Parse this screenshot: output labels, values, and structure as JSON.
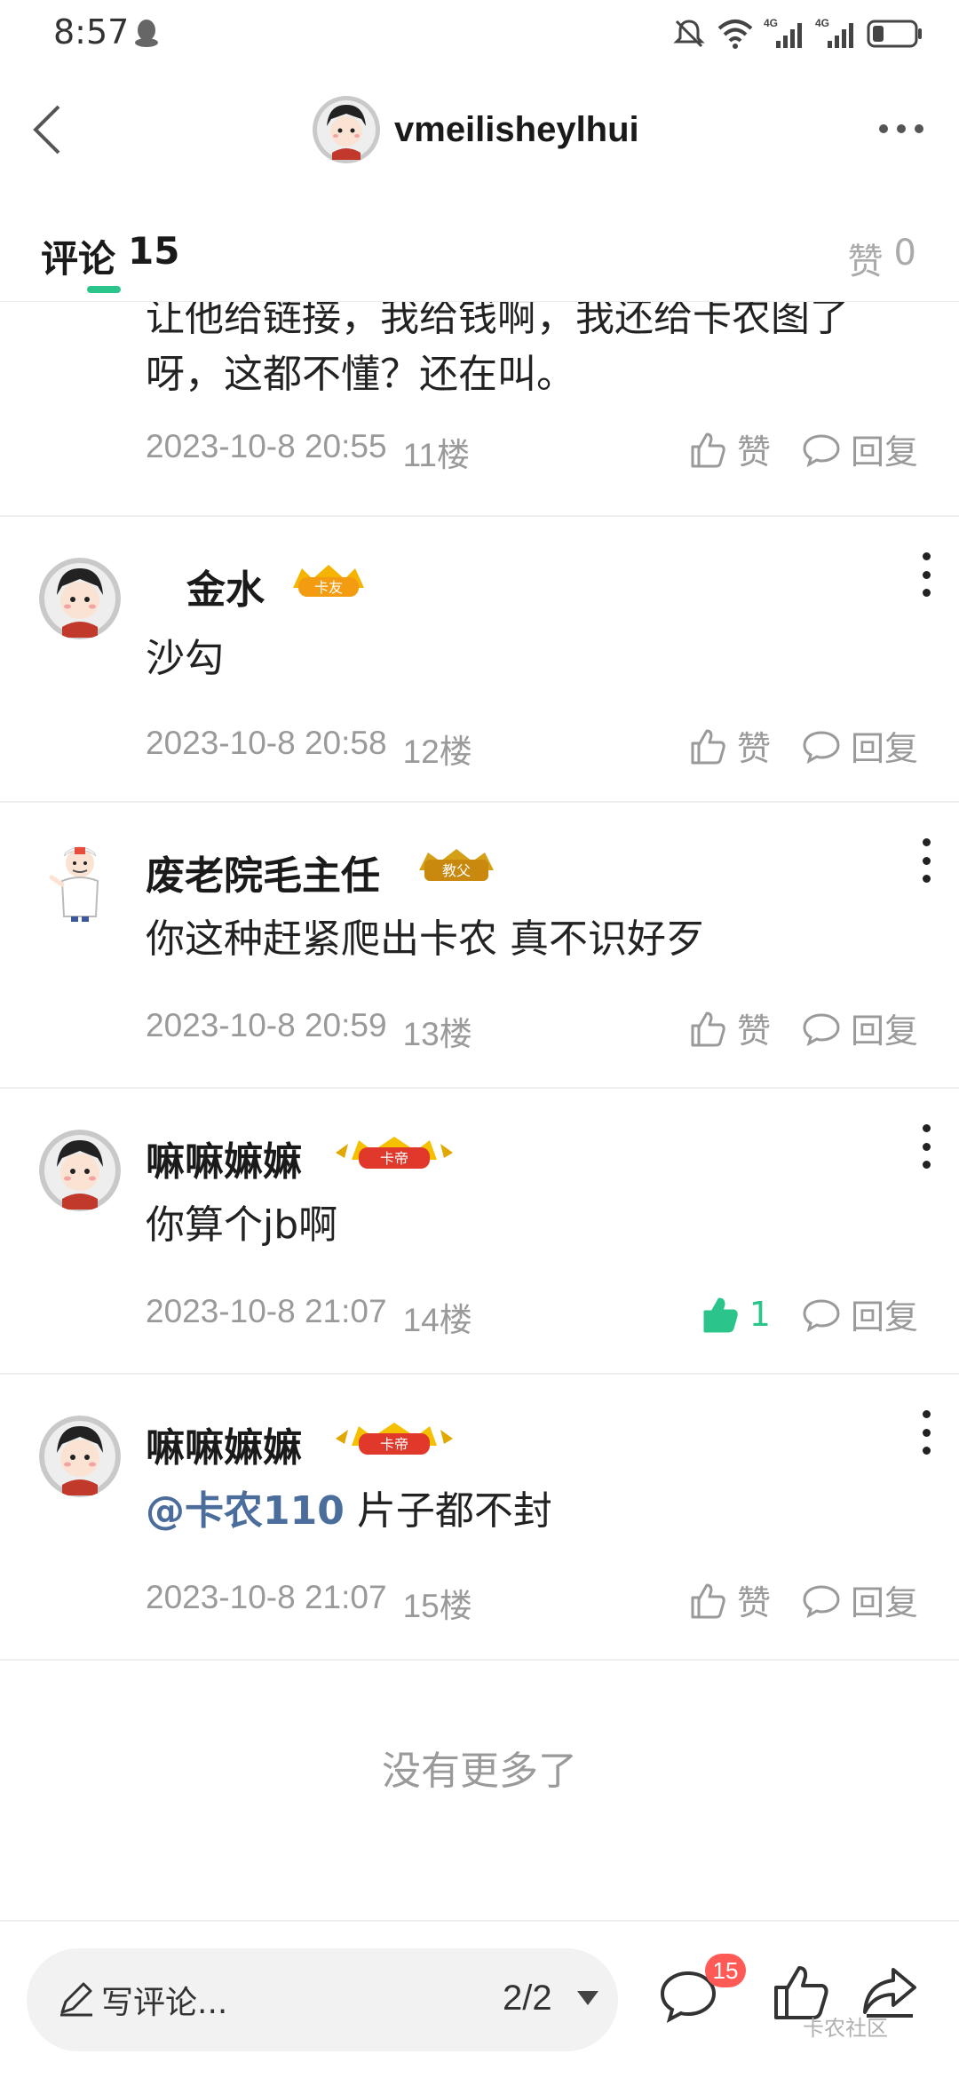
{
  "status_bar": {
    "time": "8:57",
    "icons": [
      "qq-icon",
      "mute-icon",
      "wifi-icon",
      "signal-4g-icon",
      "signal-4g-icon",
      "battery-icon"
    ],
    "network_labels": [
      "4G",
      "4G"
    ]
  },
  "nav": {
    "title": "vmeilisheylhui",
    "icons": [
      "back-icon",
      "avatar",
      "more-icon"
    ]
  },
  "tabs": {
    "comments_label": "评论",
    "comments_count": "15",
    "likes_label": "赞",
    "likes_count": "0",
    "accent_color": "#2bc48a"
  },
  "comments": [
    {
      "content_lines": [
        "让他给链接，我给钱啊，我还给卡农图了",
        "呀，这都不懂？还在叫。"
      ],
      "date": "2023-10-8 20:55",
      "floor": "11楼",
      "like_label": "赞",
      "reply_label": "回复"
    },
    {
      "username": "金水",
      "badge": "卡友",
      "content": "沙勾",
      "date": "2023-10-8 20:58",
      "floor": "12楼",
      "like_label": "赞",
      "reply_label": "回复"
    },
    {
      "username": "废老院毛主任",
      "badge": "教父",
      "content": "你这种赶紧爬出卡农 真不识好歹",
      "date": "2023-10-8 20:59",
      "floor": "13楼",
      "like_label": "赞",
      "reply_label": "回复"
    },
    {
      "username": "嘛嘛嫲嫲",
      "badge": "卡帝",
      "content": "你算个jb啊",
      "date": "2023-10-8 21:07",
      "floor": "14楼",
      "like_label": "1",
      "liked": true,
      "reply_label": "回复"
    },
    {
      "username": "嘛嘛嫲嫲",
      "badge": "卡帝",
      "mention": "@卡农110",
      "content": " 片子都不封",
      "date": "2023-10-8 21:07",
      "floor": "15楼",
      "like_label": "赞",
      "reply_label": "回复"
    }
  ],
  "footer_note": "没有更多了",
  "bottom_bar": {
    "write_label": "写评论...",
    "pager": "2/2",
    "comment_count": "15",
    "watermark": "卡农社区",
    "icons": [
      "pen-icon",
      "comment-icon",
      "thumb-up-icon",
      "share-icon"
    ]
  }
}
